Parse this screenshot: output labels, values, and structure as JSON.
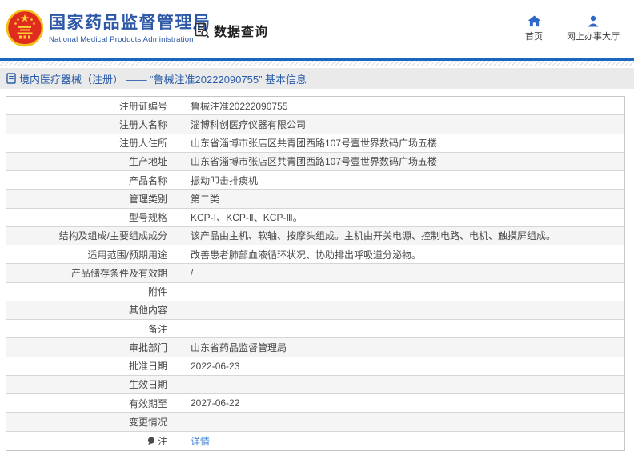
{
  "header": {
    "agency_title": "国家药品监督管理局",
    "agency_subtitle": "National Medical Products Administration",
    "query_label": "数据查询",
    "nav_home": "首页",
    "nav_hall": "网上办事大厅"
  },
  "breadcrumb": {
    "text": "境内医疗器械（注册） —— “鲁械注准20222090755” 基本信息"
  },
  "table": {
    "rows": [
      {
        "label": "注册证编号",
        "value": "鲁械注准20222090755"
      },
      {
        "label": "注册人名称",
        "value": "淄博科创医疗仪器有限公司"
      },
      {
        "label": "注册人住所",
        "value": "山东省淄博市张店区共青团西路107号壹世界数码广场五楼"
      },
      {
        "label": "生产地址",
        "value": "山东省淄博市张店区共青团西路107号壹世界数码广场五楼"
      },
      {
        "label": "产品名称",
        "value": "振动叩击排痰机"
      },
      {
        "label": "管理类别",
        "value": "第二类"
      },
      {
        "label": "型号规格",
        "value": "KCP-Ⅰ、KCP-Ⅱ、KCP-Ⅲ。"
      },
      {
        "label": "结构及组成/主要组成成分",
        "value": "该产品由主机、软轴、按摩头组成。主机由开关电源、控制电路、电机、触摸屏组成。"
      },
      {
        "label": "适用范围/预期用途",
        "value": "改善患者肺部血液循环状况、协助排出呼吸道分泌物。"
      },
      {
        "label": "产品储存条件及有效期",
        "value": "/"
      },
      {
        "label": "附件",
        "value": ""
      },
      {
        "label": "其他内容",
        "value": ""
      },
      {
        "label": "备注",
        "value": ""
      },
      {
        "label": "审批部门",
        "value": "山东省药品监督管理局"
      },
      {
        "label": "批准日期",
        "value": "2022-06-23"
      },
      {
        "label": "生效日期",
        "value": ""
      },
      {
        "label": "有效期至",
        "value": "2027-06-22"
      },
      {
        "label": "变更情况",
        "value": ""
      },
      {
        "label": "注",
        "value": "详情"
      }
    ]
  },
  "colors": {
    "accent_blue": "#1a67bd",
    "title_blue": "#2c58a6",
    "nav_icon_blue": "#2e68c8",
    "link_blue": "#4b8bd5",
    "alt_row_bg": "#f5f5f6",
    "crumb_bar_bg": "#eaeaea"
  }
}
